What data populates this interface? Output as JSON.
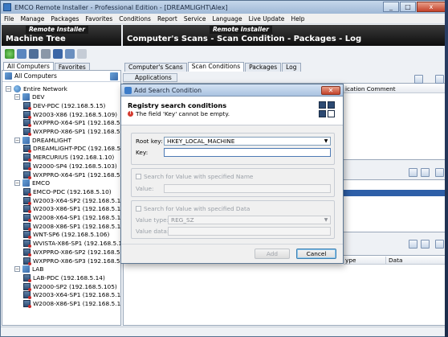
{
  "window": {
    "title": "EMCO Remote Installer - Professional Edition - [DREAMLIGHT\\Alex]",
    "controls": [
      "_",
      "□",
      "x"
    ]
  },
  "menu": [
    "File",
    "Manage",
    "Packages",
    "Favorites",
    "Conditions",
    "Report",
    "Service",
    "Language",
    "Live Update",
    "Help"
  ],
  "brand": "Remote Installer",
  "left_pane": {
    "title": "Machine Tree",
    "tabs": [
      "All Computers",
      "Favorites"
    ],
    "header": "All Computers",
    "tree": [
      {
        "label": "Entire Network",
        "level": 0,
        "type": "network"
      },
      {
        "label": "DEV",
        "level": 1,
        "type": "group"
      },
      {
        "label": "DEV-PDC  (192.168.5.15)",
        "level": 2,
        "type": "pc"
      },
      {
        "label": "W2003-X86  (192.168.5.109)",
        "level": 2,
        "type": "pc"
      },
      {
        "label": "WXPPRO-X64-SP1  (192.168.5.1",
        "level": 2,
        "type": "pc"
      },
      {
        "label": "WXPPRO-X86-SP1  (192.168.5.1",
        "level": 2,
        "type": "pc"
      },
      {
        "label": "DREAMLIGHT",
        "level": 1,
        "type": "group"
      },
      {
        "label": "DREAMLIGHT-PDC  (192.168.5.2",
        "level": 2,
        "type": "pc"
      },
      {
        "label": "MERCURIUS  (192.168.1.10)",
        "level": 2,
        "type": "pc"
      },
      {
        "label": "W2000-SP4  (192.168.5.103)",
        "level": 2,
        "type": "pc"
      },
      {
        "label": "WXPPRO-X64-SP1  (192.168.5.1",
        "level": 2,
        "type": "pc"
      },
      {
        "label": "EMCO",
        "level": 1,
        "type": "group"
      },
      {
        "label": "EMCO-PDC  (192.168.5.10)",
        "level": 2,
        "type": "pc"
      },
      {
        "label": "W2003-X64-SP2  (192.168.5.1",
        "level": 2,
        "type": "pc"
      },
      {
        "label": "W2003-X86-SP1  (192.168.5.1",
        "level": 2,
        "type": "pc"
      },
      {
        "label": "W2008-X64-SP1  (192.168.5.1",
        "level": 2,
        "type": "pc"
      },
      {
        "label": "W2008-X86-SP1  (192.168.5.1",
        "level": 2,
        "type": "pc"
      },
      {
        "label": "WNT-SP6  (192.168.5.106)",
        "level": 2,
        "type": "pc"
      },
      {
        "label": "WVISTA-X86-SP1  (192.168.5.1",
        "level": 2,
        "type": "pc"
      },
      {
        "label": "WXPPRO-X86-SP2  (192.168.5.1",
        "level": 2,
        "type": "pc"
      },
      {
        "label": "WXPPRO-X86-SP3  (192.168.5.1",
        "level": 2,
        "type": "pc"
      },
      {
        "label": "LAB",
        "level": 1,
        "type": "group"
      },
      {
        "label": "LAB-PDC  (192.168.5.14)",
        "level": 2,
        "type": "pc"
      },
      {
        "label": "W2000-SP2  (192.168.5.105)",
        "level": 2,
        "type": "pc"
      },
      {
        "label": "W2003-X64-SP1  (192.168.5.1",
        "level": 2,
        "type": "pc"
      },
      {
        "label": "W2008-X86-SP1  (192.168.5.1",
        "level": 2,
        "type": "pc"
      }
    ]
  },
  "right_pane": {
    "title": "Computer's Scans - Scan Condition - Packages - Log",
    "tabs": [
      "Computer's Scans",
      "Scan Conditions",
      "Packages",
      "Log"
    ],
    "applications_tab": "Applications",
    "grid_header_partial": "ication Comment",
    "bottom_grid_headers": [
      "ype",
      "Data"
    ]
  },
  "dialog": {
    "title": "Add Search Condition",
    "heading": "Registry search conditions",
    "error": "The field 'Key' cannot be empty.",
    "root_key_label": "Root key:",
    "root_key_value": "HKEY_LOCAL_MACHINE",
    "key_label": "Key:",
    "key_value": "",
    "search_name_label": "Search for Value with specified Name",
    "value_label": "Value:",
    "search_data_label": "Search for Value with specified Data",
    "value_type_label": "Value type:",
    "value_type_value": "REG_SZ",
    "value_data_label": "Value data:",
    "add_button": "Add",
    "cancel_button": "Cancel"
  },
  "colors": {
    "accent": "#2e5fa8",
    "header_dark": "#1a1a1a",
    "error": "#d43a2f"
  }
}
